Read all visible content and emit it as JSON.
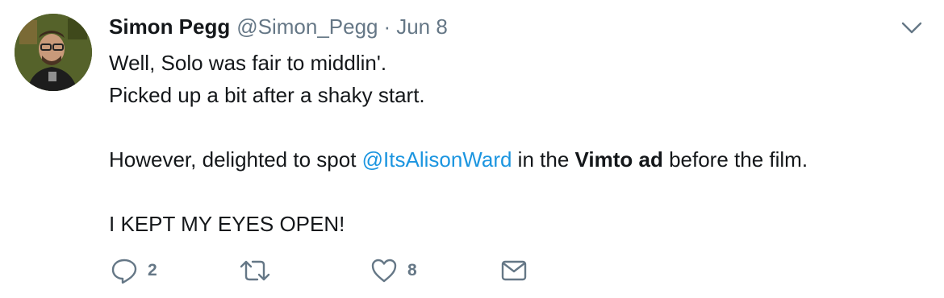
{
  "tweet": {
    "author_name": "Simon Pegg",
    "handle": "@Simon_Pegg",
    "separator": "·",
    "date": "Jun 8",
    "lines": {
      "line1": "Well, Solo was fair to middlin'.",
      "line2": "Picked up a bit after a shaky start.",
      "line3_prefix": "However, delighted to spot ",
      "line3_mention": "@ItsAlisonWard",
      "line3_middle": " in the ",
      "line3_bold": "Vimto ad",
      "line3_suffix": " before the film.",
      "line4": "I KEPT MY EYES OPEN!"
    }
  },
  "actions": {
    "reply_count": "2",
    "retweet_count": "",
    "like_count": "8"
  },
  "icons": {
    "reply": "reply-icon",
    "retweet": "retweet-icon",
    "like": "heart-icon",
    "message": "envelope-icon",
    "more": "chevron-down-icon"
  },
  "colors": {
    "mention": "#1b95e0",
    "muted": "#657786",
    "text": "#14171a"
  }
}
